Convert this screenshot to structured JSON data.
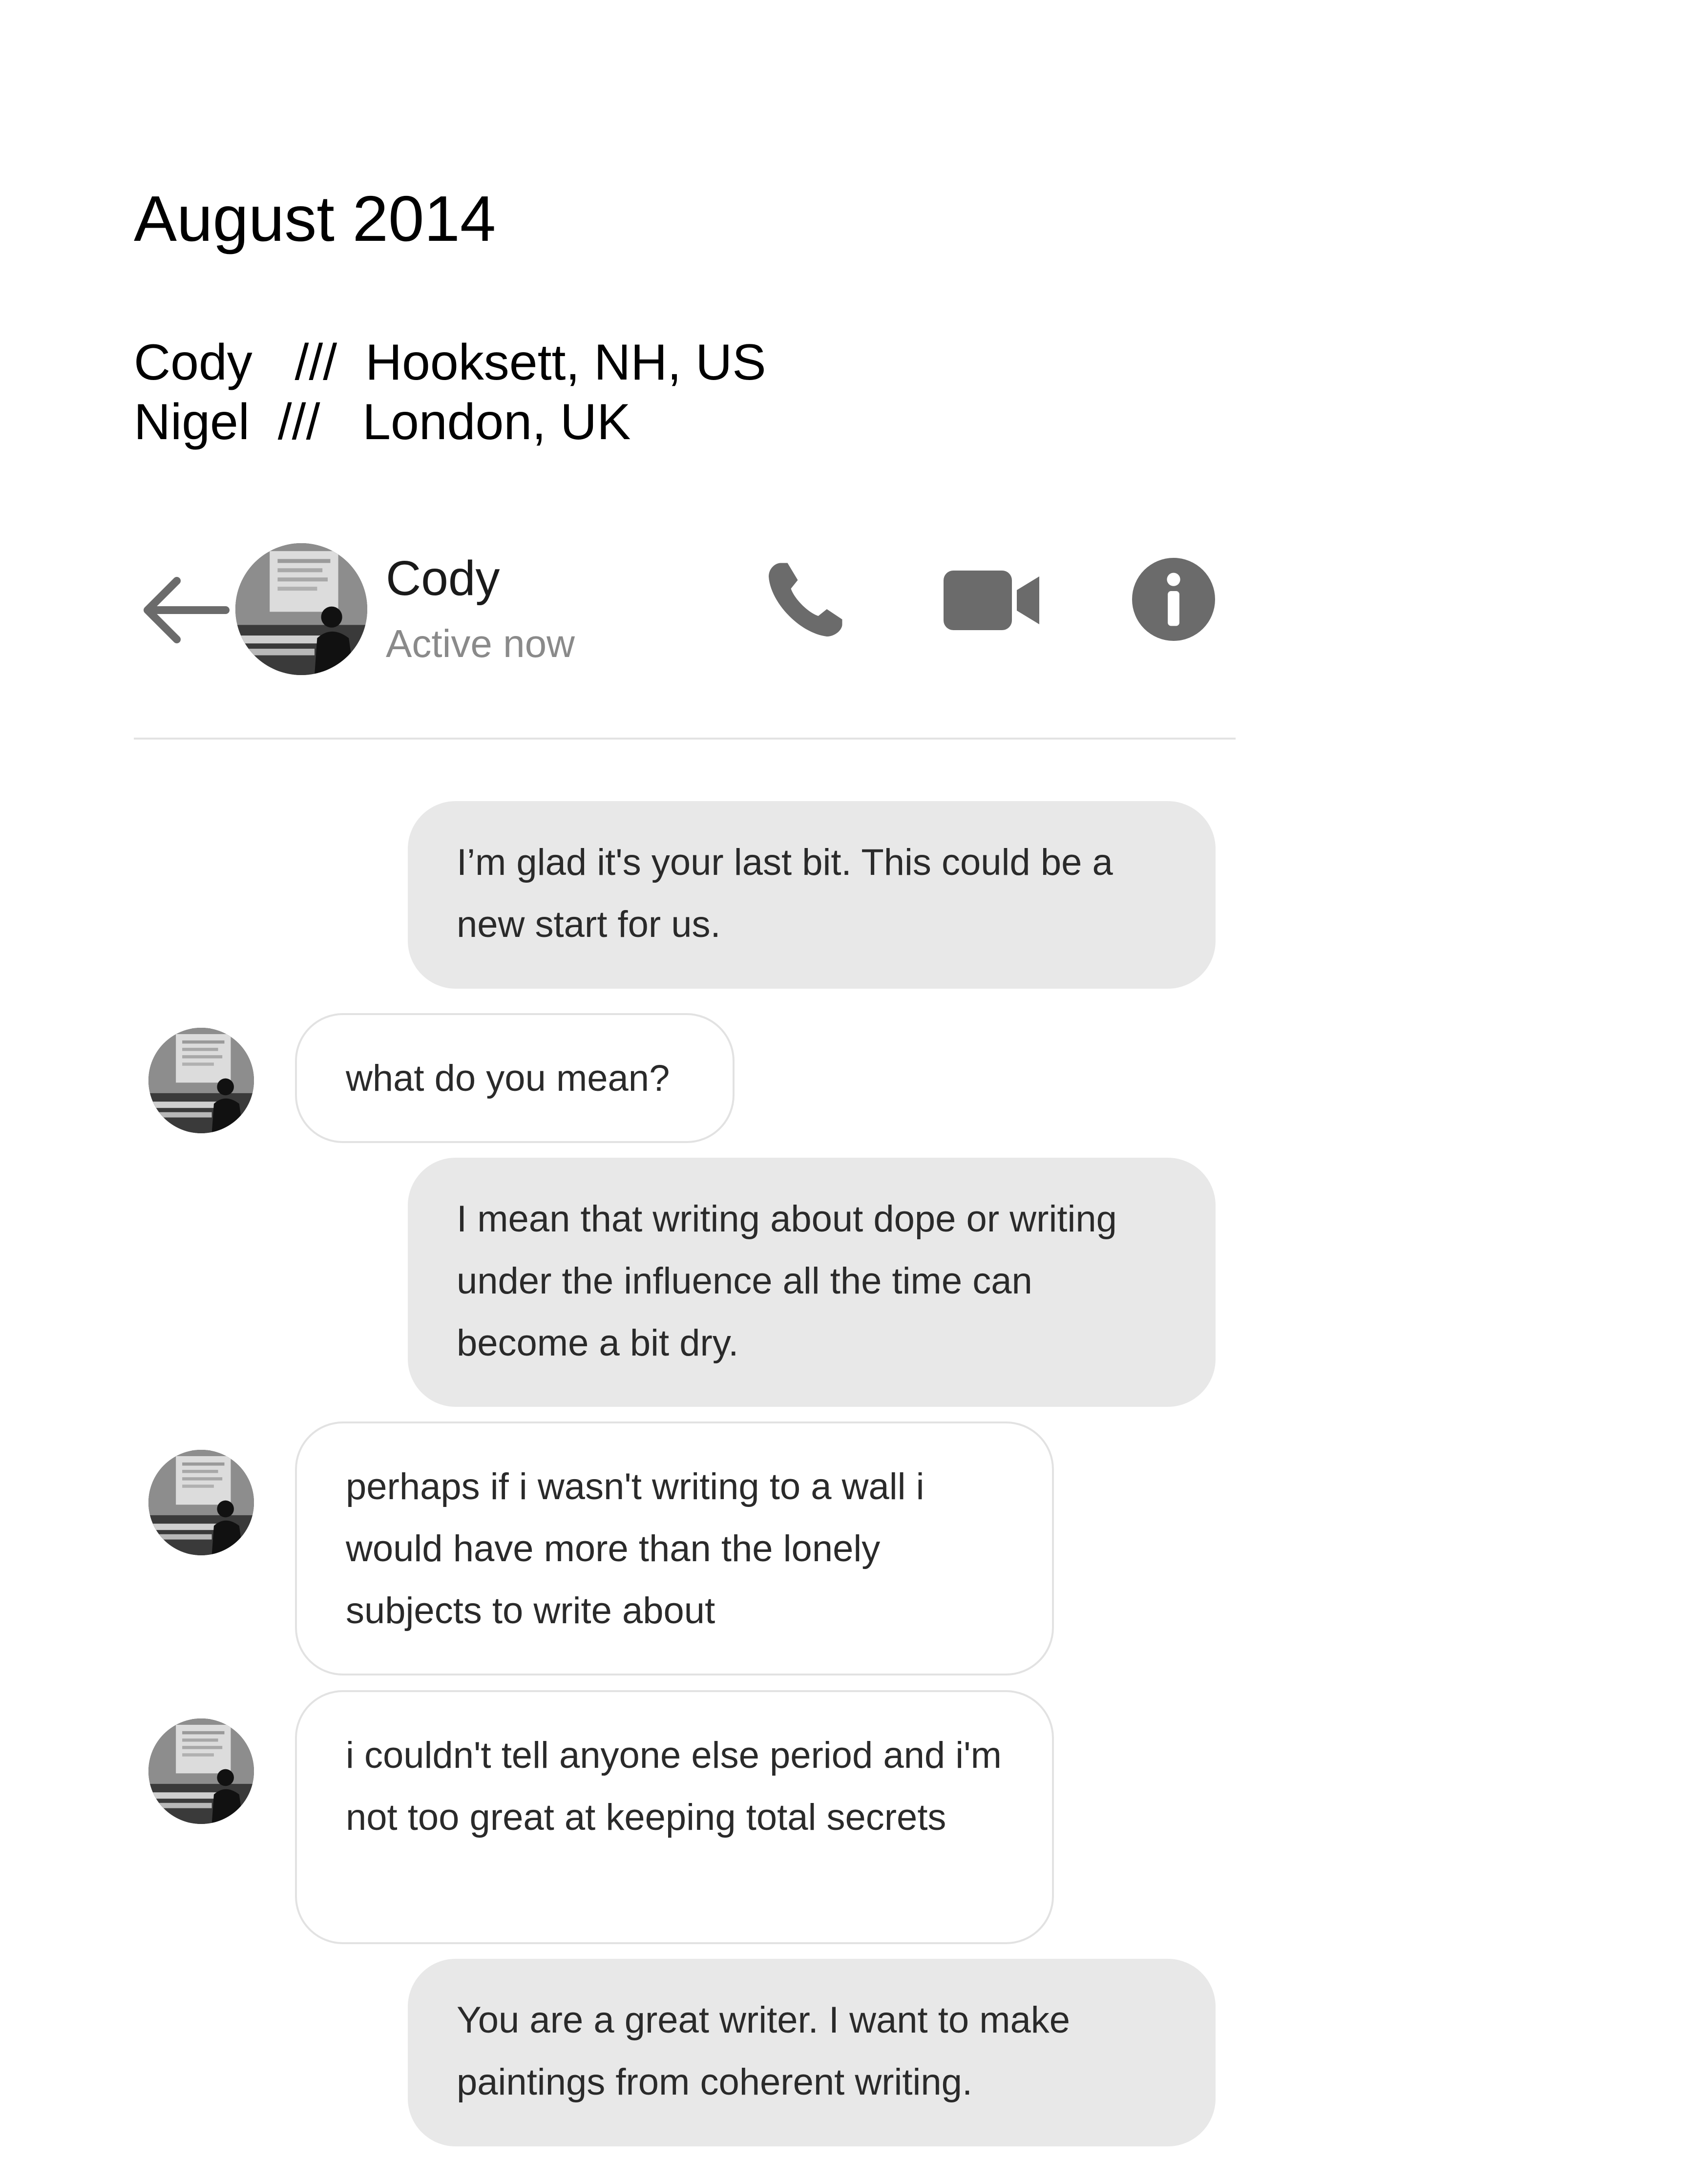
{
  "page": {
    "title": "August 2014",
    "locations": [
      "Cody   ///  Hooksett, NH, US",
      "Nigel  ///   London, UK"
    ]
  },
  "chat_header": {
    "contact_name": "Cody",
    "status": "Active now",
    "icons": [
      "back-arrow-icon",
      "phone-icon",
      "video-camera-icon",
      "info-icon"
    ]
  },
  "messages": [
    {
      "direction": "sent",
      "text": "I’m glad it's your last bit. This could be a new start for us."
    },
    {
      "direction": "received",
      "text": "what do you mean?"
    },
    {
      "direction": "sent",
      "text": "I mean that writing about dope or writing under the influence all the time can become a bit dry."
    },
    {
      "direction": "received",
      "text": "perhaps if i wasn't writing to a wall i would have more than the lonely subjects to write about"
    },
    {
      "direction": "received",
      "text": "i couldn't tell anyone else period and i'm not too great at keeping total secrets"
    },
    {
      "direction": "sent",
      "text": "You are a great writer. I want to make paintings from coherent writing."
    }
  ],
  "colors": {
    "sent_bubble": "#e8e8e8",
    "received_bubble_border": "#e2e2e2",
    "icon": "#6b6b6b",
    "status_text": "#8a8a8a"
  }
}
